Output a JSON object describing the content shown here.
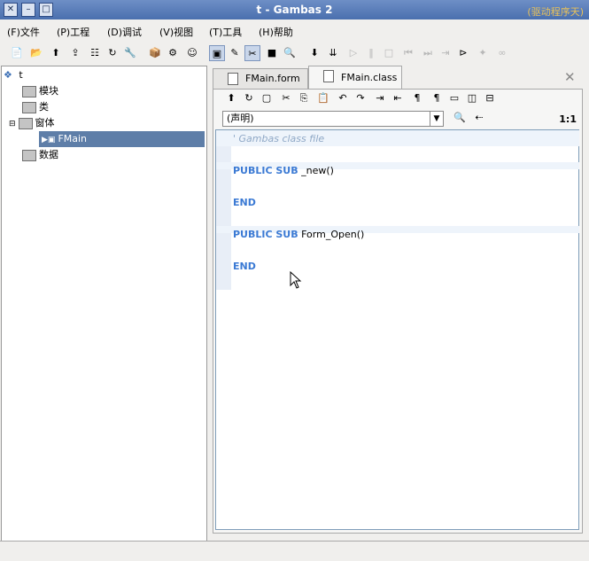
{
  "window": {
    "title": "t - Gambas 2",
    "watermark": "(驱动程序天)"
  },
  "menu": [
    "(F)文件",
    "(P)工程",
    "(D)调试",
    "(V)视图",
    "(T)工具",
    "(H)帮助"
  ],
  "project_tree": {
    "root": "t",
    "items": [
      {
        "label": "模块"
      },
      {
        "label": "类"
      },
      {
        "label": "窗体",
        "expanded": true
      },
      {
        "label": "FMain",
        "selected": true
      },
      {
        "label": "数据"
      }
    ]
  },
  "tabs": [
    {
      "label": "FMain.form",
      "active": false
    },
    {
      "label": "FMain.class",
      "active": true
    }
  ],
  "editor": {
    "procedure_combo": "(声明)",
    "position": "1:1",
    "lines": [
      {
        "comment": "' Gambas class file"
      },
      {
        "text": ""
      },
      {
        "kw": "PUBLIC SUB",
        "rest": " _new()"
      },
      {
        "text": ""
      },
      {
        "kw": "END",
        "rest": ""
      },
      {
        "text": ""
      },
      {
        "kw": "PUBLIC SUB",
        "rest": " Form_Open()"
      },
      {
        "text": ""
      },
      {
        "kw": "END",
        "rest": ""
      }
    ]
  },
  "colors": {
    "keyword": "#3b7ad4",
    "comment": "#8fa8c6",
    "selection": "#5e7ea8"
  }
}
